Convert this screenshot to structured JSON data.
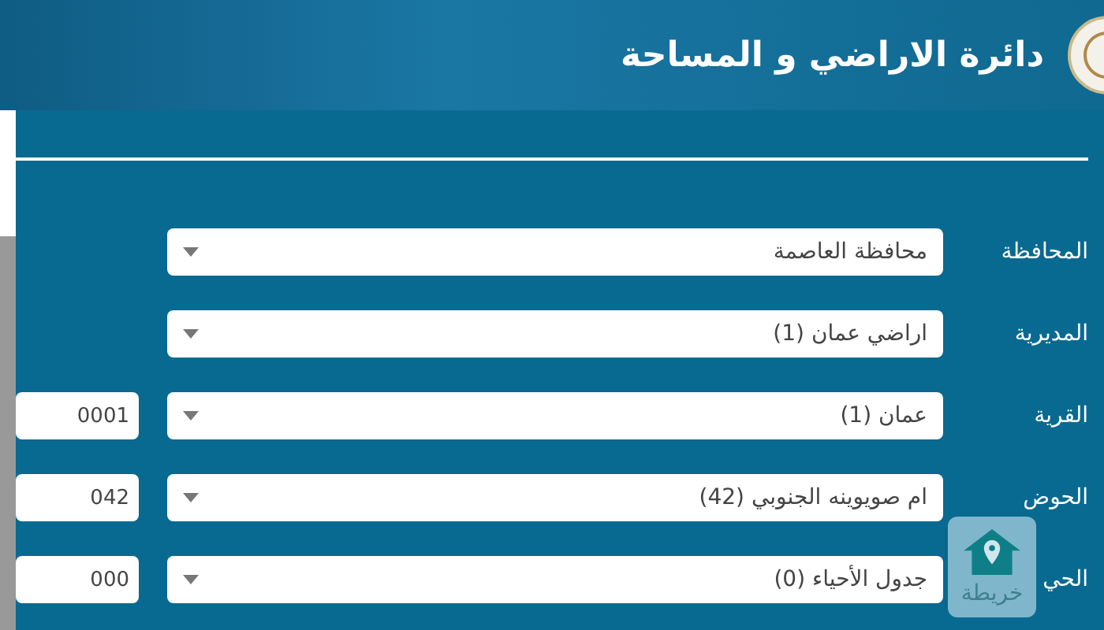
{
  "header": {
    "title": "دائرة الاراضي و المساحة"
  },
  "fields": [
    {
      "label": "المحافظة",
      "value": "محافظة العاصمة"
    },
    {
      "label": "المديرية",
      "value": "اراضي عمان (1)"
    },
    {
      "label": "القرية",
      "value": "عمان (1)",
      "code": "0001"
    },
    {
      "label": "الحوض",
      "value": "ام صويوينه الجنوبي (42)",
      "code": "042"
    },
    {
      "label": "الحي",
      "value": "جدول الأحياء (0)",
      "code": "000"
    }
  ],
  "map_button": {
    "label": "خريطة"
  }
}
